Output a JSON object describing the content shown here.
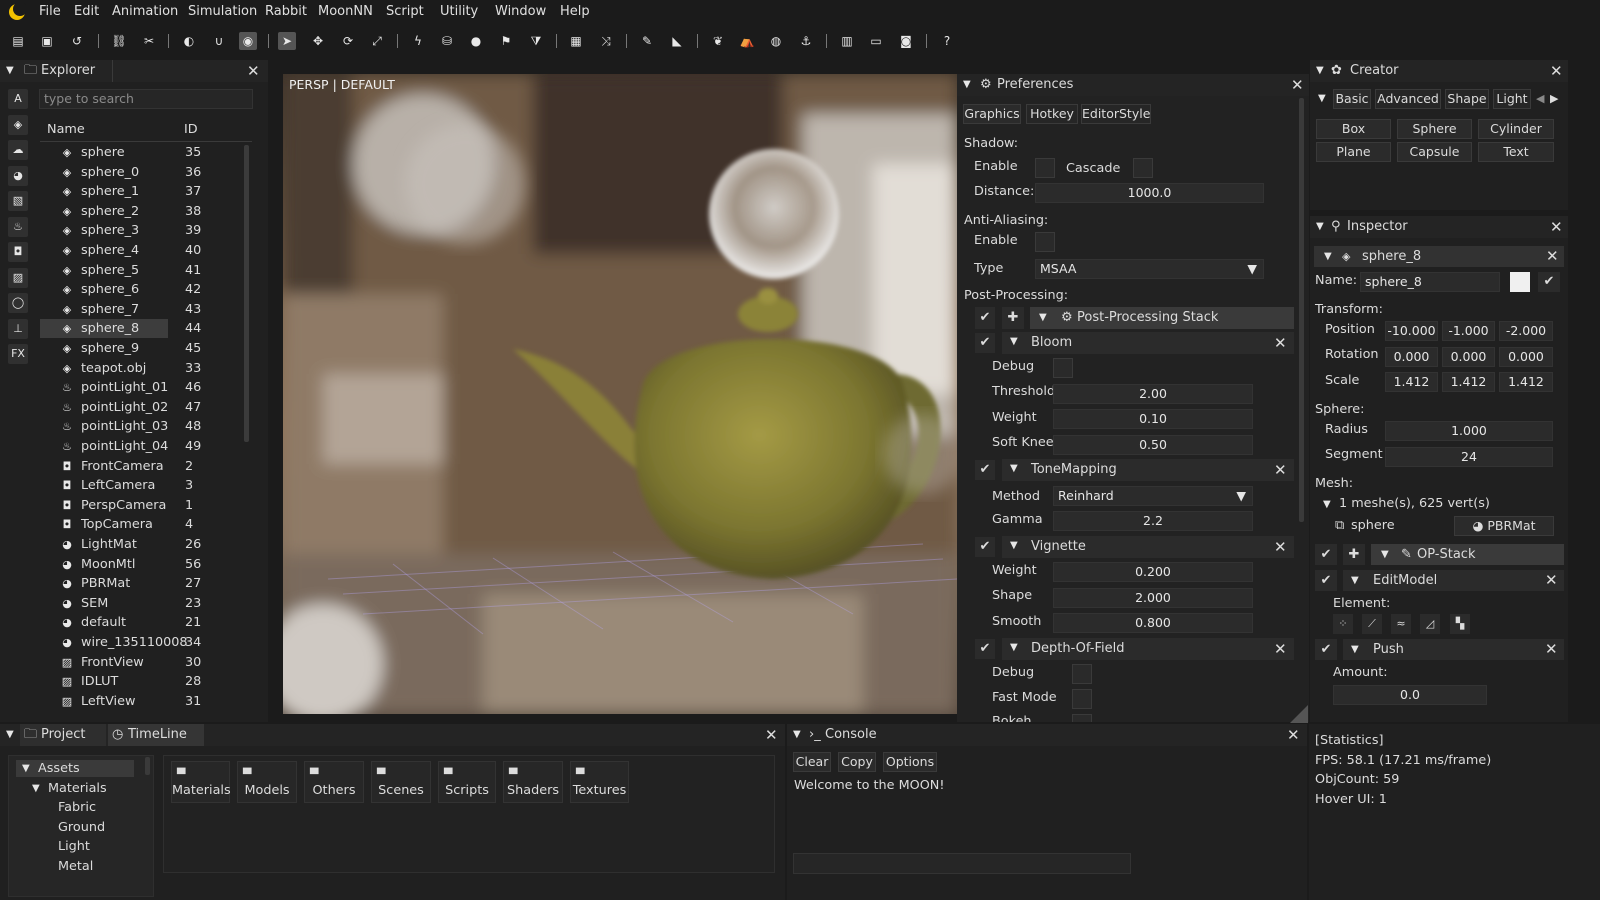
{
  "menubar": {
    "items": [
      "File",
      "Edit",
      "Animation",
      "Simulation",
      "Rabbit",
      "MoonNN",
      "Script",
      "Utility",
      "Window",
      "Help"
    ]
  },
  "toolbar": {
    "icons": [
      "new-file-icon",
      "save-icon",
      "undo-icon",
      "link-icon",
      "unlink-icon",
      "toggle-icon",
      "magnet-icon",
      "target-icon",
      "select-arrow-icon",
      "move-icon",
      "rotate-icon",
      "scale-icon",
      "lightning-icon",
      "paint-bucket-icon",
      "drop-icon",
      "flag-icon",
      "funnel-icon",
      "grid-icon",
      "shuffle-icon",
      "brush-icon",
      "terrain-icon",
      "leaf-icon",
      "tent-icon",
      "globe-icon",
      "anchor-icon",
      "panel-icon",
      "window-icon",
      "camera-icon",
      "help-icon"
    ]
  },
  "explorer": {
    "title": "Explorer",
    "search_placeholder": "type to search",
    "col_name": "Name",
    "col_id": "ID",
    "side_a": "A",
    "side_fx": "FX",
    "rows": [
      {
        "name": "sphere",
        "id": "35",
        "icon": "cube-icon"
      },
      {
        "name": "sphere_0",
        "id": "36",
        "icon": "cube-icon"
      },
      {
        "name": "sphere_1",
        "id": "37",
        "icon": "cube-icon"
      },
      {
        "name": "sphere_2",
        "id": "38",
        "icon": "cube-icon"
      },
      {
        "name": "sphere_3",
        "id": "39",
        "icon": "cube-icon"
      },
      {
        "name": "sphere_4",
        "id": "40",
        "icon": "cube-icon"
      },
      {
        "name": "sphere_5",
        "id": "41",
        "icon": "cube-icon"
      },
      {
        "name": "sphere_6",
        "id": "42",
        "icon": "cube-icon"
      },
      {
        "name": "sphere_7",
        "id": "43",
        "icon": "cube-icon"
      },
      {
        "name": "sphere_8",
        "id": "44",
        "icon": "cube-icon",
        "selected": true
      },
      {
        "name": "sphere_9",
        "id": "45",
        "icon": "cube-icon"
      },
      {
        "name": "teapot.obj",
        "id": "33",
        "icon": "cube-icon"
      },
      {
        "name": "pointLight_01",
        "id": "46",
        "icon": "bulb-icon"
      },
      {
        "name": "pointLight_02",
        "id": "47",
        "icon": "bulb-icon"
      },
      {
        "name": "pointLight_03",
        "id": "48",
        "icon": "bulb-icon"
      },
      {
        "name": "pointLight_04",
        "id": "49",
        "icon": "bulb-icon"
      },
      {
        "name": "FrontCamera",
        "id": "2",
        "icon": "camera-icon"
      },
      {
        "name": "LeftCamera",
        "id": "3",
        "icon": "camera-icon"
      },
      {
        "name": "PerspCamera",
        "id": "1",
        "icon": "camera-icon"
      },
      {
        "name": "TopCamera",
        "id": "4",
        "icon": "camera-icon"
      },
      {
        "name": "LightMat",
        "id": "26",
        "icon": "material-icon"
      },
      {
        "name": "MoonMtl",
        "id": "56",
        "icon": "material-icon"
      },
      {
        "name": "PBRMat",
        "id": "27",
        "icon": "material-icon"
      },
      {
        "name": "SEM",
        "id": "23",
        "icon": "material-icon"
      },
      {
        "name": "default",
        "id": "21",
        "icon": "material-icon"
      },
      {
        "name": "wire_135110008",
        "id": "34",
        "icon": "material-icon"
      },
      {
        "name": "FrontView",
        "id": "30",
        "icon": "image-icon"
      },
      {
        "name": "IDLUT",
        "id": "28",
        "icon": "image-icon"
      },
      {
        "name": "LeftView",
        "id": "31",
        "icon": "image-icon"
      }
    ]
  },
  "viewport": {
    "mode": "PERSP",
    "separator": "|",
    "shading": "DEFAULT"
  },
  "preferences": {
    "title": "Preferences",
    "tabs": [
      "Graphics",
      "Hotkey",
      "EditorStyle"
    ],
    "shadow_label": "Shadow:",
    "enable_label": "Enable",
    "cascade_label": "Cascade",
    "distance_label": "Distance:",
    "distance_value": "1000.0",
    "aa_label": "Anti-Aliasing:",
    "aa_enable_label": "Enable",
    "type_label": "Type",
    "type_value": "MSAA",
    "pp_label": "Post-Processing:",
    "pp_stack": "Post-Processing Stack",
    "bloom": {
      "title": "Bloom",
      "debug": "Debug",
      "threshold_label": "Threshold",
      "threshold": "2.00",
      "weight_label": "Weight",
      "weight": "0.10",
      "softknee_label": "Soft Knee",
      "softknee": "0.50"
    },
    "tonemap": {
      "title": "ToneMapping",
      "method_label": "Method",
      "method": "Reinhard",
      "gamma_label": "Gamma",
      "gamma": "2.2"
    },
    "vignette": {
      "title": "Vignette",
      "weight_label": "Weight",
      "weight": "0.200",
      "shape_label": "Shape",
      "shape": "2.000",
      "smooth_label": "Smooth",
      "smooth": "0.800"
    },
    "dof": {
      "title": "Depth-Of-Field",
      "debug": "Debug",
      "fastmode": "Fast Mode",
      "bokeh": "Bokeh"
    }
  },
  "creator": {
    "title": "Creator",
    "tabs": [
      "Basic",
      "Advanced",
      "Shape",
      "Light"
    ],
    "buttons": [
      "Box",
      "Sphere",
      "Cylinder",
      "Plane",
      "Capsule",
      "Text"
    ]
  },
  "inspector": {
    "title": "Inspector",
    "object": "sphere_8",
    "name_label": "Name:",
    "name_value": "sphere_8",
    "transform_label": "Transform:",
    "position_label": "Position",
    "position": [
      "-10.000",
      "-1.000",
      "-2.000"
    ],
    "rotation_label": "Rotation",
    "rotation": [
      "0.000",
      "0.000",
      "0.000"
    ],
    "scale_label": "Scale",
    "scale": [
      "1.412",
      "1.412",
      "1.412"
    ],
    "sphere_label": "Sphere:",
    "radius_label": "Radius",
    "radius": "1.000",
    "segment_label": "Segment",
    "segment": "24",
    "mesh_label": "Mesh:",
    "mesh_summary": "1 meshe(s), 625 vert(s)",
    "mesh_name": "sphere",
    "mesh_mat": "PBRMat",
    "opstack": "OP-Stack",
    "editmodel": "EditModel",
    "element_label": "Element:",
    "push": "Push",
    "amount_label": "Amount:",
    "amount": "0.0"
  },
  "project": {
    "tab_project": "Project",
    "tab_timeline": "TimeLine",
    "tree": [
      {
        "label": "Assets",
        "level": 0,
        "expander": "▼"
      },
      {
        "label": "Materials",
        "level": 1,
        "expander": "▼"
      },
      {
        "label": "Fabric",
        "level": 2,
        "expander": ""
      },
      {
        "label": "Ground",
        "level": 2,
        "expander": ""
      },
      {
        "label": "Light",
        "level": 2,
        "expander": ""
      },
      {
        "label": "Metal",
        "level": 2,
        "expander": ""
      }
    ],
    "folders": [
      "Materials",
      "Models",
      "Others",
      "Scenes",
      "Scripts",
      "Shaders",
      "Textures"
    ]
  },
  "console": {
    "title": "Console",
    "buttons": [
      "Clear",
      "Copy",
      "Options"
    ],
    "message": "Welcome to the MOON!"
  },
  "stats": {
    "title": "[Statistics]",
    "fps": "FPS: 58.1 (17.21 ms/frame)",
    "objcount": "ObjCount: 59",
    "hover": "Hover UI: 1"
  }
}
